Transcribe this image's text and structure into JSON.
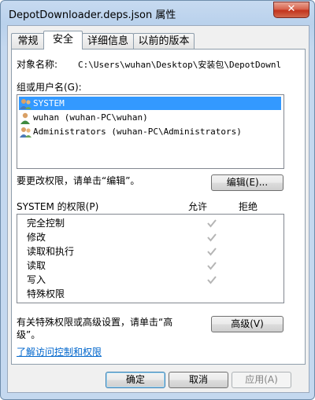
{
  "window": {
    "title": "DepotDownloader.deps.json 属性",
    "close_label": "✕"
  },
  "tabs": [
    {
      "label": "常规"
    },
    {
      "label": "安全"
    },
    {
      "label": "详细信息"
    },
    {
      "label": "以前的版本"
    }
  ],
  "object_name": {
    "label": "对象名称:",
    "value": "C:\\Users\\wuhan\\Desktop\\安装包\\DepotDownl"
  },
  "principals": {
    "label": "组或用户名(G):",
    "items": [
      {
        "name": "SYSTEM",
        "icon": "group-icon",
        "selected": true
      },
      {
        "name": "wuhan (wuhan-PC\\wuhan)",
        "icon": "user-icon",
        "selected": false
      },
      {
        "name": "Administrators (wuhan-PC\\Administrators)",
        "icon": "group-icon",
        "selected": false
      }
    ]
  },
  "edit": {
    "hint": "要更改权限，请单击“编辑”。",
    "button": "编辑(E)..."
  },
  "permissions": {
    "header": "SYSTEM 的权限(P)",
    "allow_label": "允许",
    "deny_label": "拒绝",
    "rows": [
      {
        "name": "完全控制",
        "allow": true,
        "deny": false
      },
      {
        "name": "修改",
        "allow": true,
        "deny": false
      },
      {
        "name": "读取和执行",
        "allow": true,
        "deny": false
      },
      {
        "name": "读取",
        "allow": true,
        "deny": false
      },
      {
        "name": "写入",
        "allow": true,
        "deny": false
      },
      {
        "name": "特殊权限",
        "allow": false,
        "deny": false
      }
    ]
  },
  "advanced": {
    "hint_line1": "有关特殊权限或高级设置，请单击“高",
    "hint_line2": "级”。",
    "button": "高级(V)"
  },
  "learn_link": "了解访问控制和权限",
  "footer": {
    "ok": "确定",
    "cancel": "取消",
    "apply": "应用(A)"
  },
  "colors": {
    "selection": "#3399ff",
    "link": "#0066cc",
    "check": "#b5b5b5"
  }
}
